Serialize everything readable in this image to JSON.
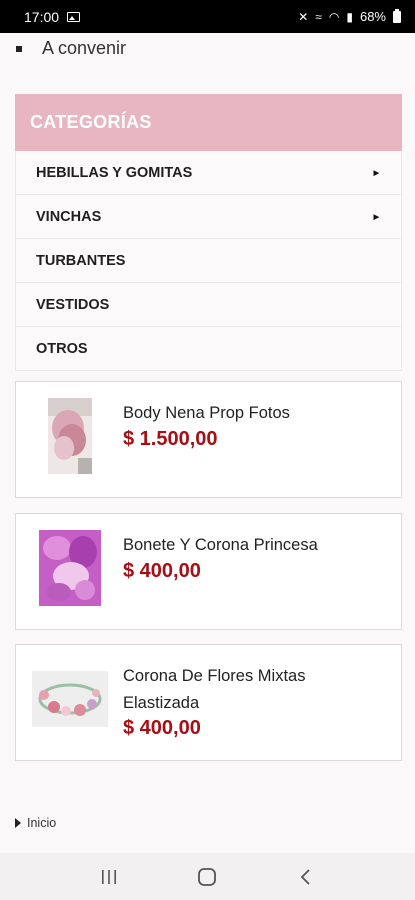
{
  "status_bar": {
    "time": "17:00",
    "battery": "68%"
  },
  "shipping": {
    "option": "A convenir"
  },
  "categories": {
    "title": "CATEGORÍAS",
    "items": [
      {
        "label": "HEBILLAS Y GOMITAS",
        "expandable": true
      },
      {
        "label": "VINCHAS",
        "expandable": true
      },
      {
        "label": "TURBANTES",
        "expandable": false
      },
      {
        "label": "VESTIDOS",
        "expandable": false
      },
      {
        "label": "OTROS",
        "expandable": false
      }
    ]
  },
  "products": [
    {
      "name": "Body Nena Prop Fotos",
      "price": "$ 1.500,00"
    },
    {
      "name": "Bonete Y Corona Princesa",
      "price": "$ 400,00"
    },
    {
      "name": "Corona De Flores Mixtas Elastizada",
      "price": "$ 400,00"
    }
  ],
  "breadcrumb": {
    "home": "Inicio"
  },
  "colors": {
    "category_header": "#e8b6c0",
    "price": "#a50f15"
  }
}
